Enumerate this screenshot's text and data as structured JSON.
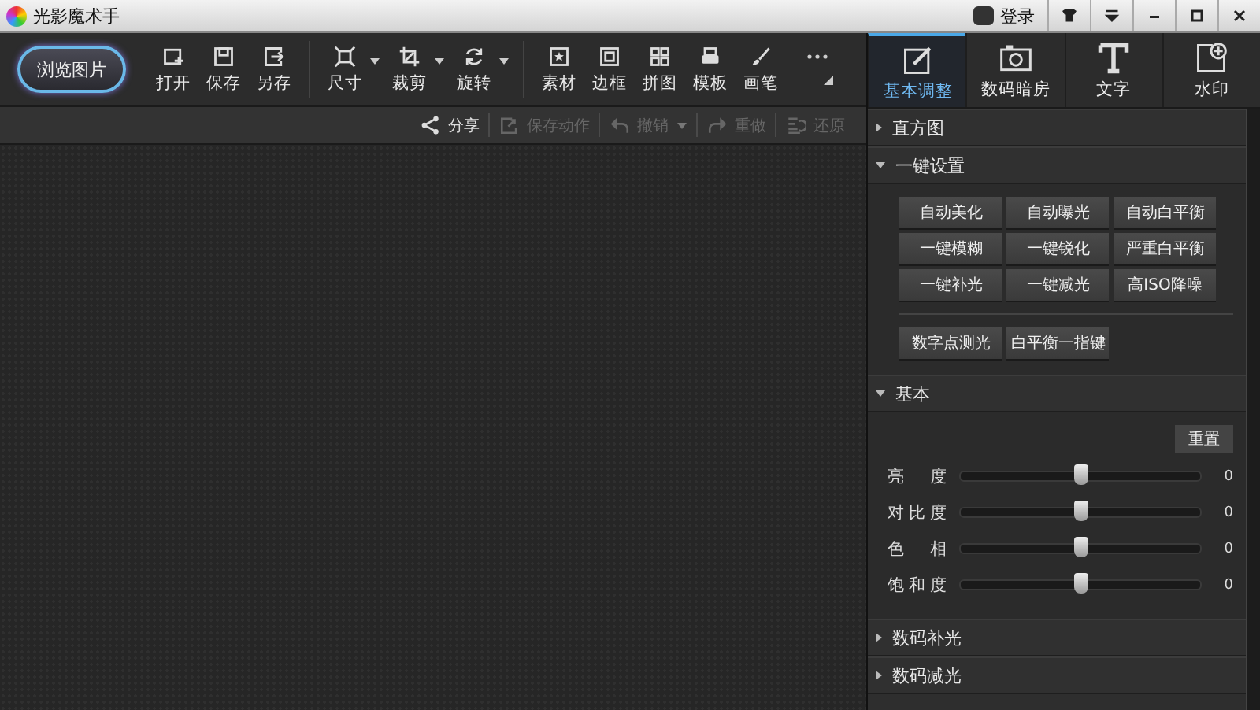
{
  "window": {
    "title": "光影魔术手",
    "login": "登录"
  },
  "browse_button": "浏览图片",
  "toolbar": [
    {
      "label": "打开",
      "dropdown": false,
      "group_start": false
    },
    {
      "label": "保存",
      "dropdown": false,
      "group_start": false
    },
    {
      "label": "另存",
      "dropdown": false,
      "group_start": false
    },
    {
      "label": "尺寸",
      "dropdown": true,
      "group_start": true
    },
    {
      "label": "裁剪",
      "dropdown": true,
      "group_start": false
    },
    {
      "label": "旋转",
      "dropdown": true,
      "group_start": false
    },
    {
      "label": "素材",
      "dropdown": false,
      "group_start": true
    },
    {
      "label": "边框",
      "dropdown": false,
      "group_start": false
    },
    {
      "label": "拼图",
      "dropdown": false,
      "group_start": false
    },
    {
      "label": "模板",
      "dropdown": false,
      "group_start": false
    },
    {
      "label": "画笔",
      "dropdown": false,
      "group_start": false
    }
  ],
  "tabs": [
    {
      "label": "基本调整",
      "selected": true
    },
    {
      "label": "数码暗房",
      "selected": false
    },
    {
      "label": "文字",
      "selected": false
    },
    {
      "label": "水印",
      "selected": false
    }
  ],
  "actions": [
    {
      "label": "分享",
      "disabled": false,
      "dropdown": false
    },
    {
      "label": "保存动作",
      "disabled": true,
      "dropdown": false
    },
    {
      "label": "撤销",
      "disabled": true,
      "dropdown": true
    },
    {
      "label": "重做",
      "disabled": true,
      "dropdown": false
    },
    {
      "label": "还原",
      "disabled": true,
      "dropdown": false
    }
  ],
  "sections": [
    {
      "title": "直方图",
      "expanded": false
    },
    {
      "kind": "presets",
      "title": "一键设置",
      "expanded": true,
      "buttons": [
        "自动美化",
        "自动曝光",
        "自动白平衡",
        "一键模糊",
        "一键锐化",
        "严重白平衡",
        "一键补光",
        "一键减光",
        "高ISO降噪"
      ],
      "extra_buttons": [
        "数字点测光",
        "白平衡一指键"
      ]
    },
    {
      "kind": "sliders",
      "title": "基本",
      "expanded": true,
      "reset": "重置",
      "sliders": [
        {
          "label": "亮度",
          "level": 0.5,
          "reading": "0"
        },
        {
          "label": "对比度",
          "level": 0.5,
          "reading": "0"
        },
        {
          "label": "色相",
          "level": 0.5,
          "reading": "0"
        },
        {
          "label": "饱和度",
          "level": 0.5,
          "reading": "0"
        }
      ]
    },
    {
      "title": "数码补光",
      "expanded": false
    },
    {
      "title": "数码减光",
      "expanded": false
    }
  ]
}
